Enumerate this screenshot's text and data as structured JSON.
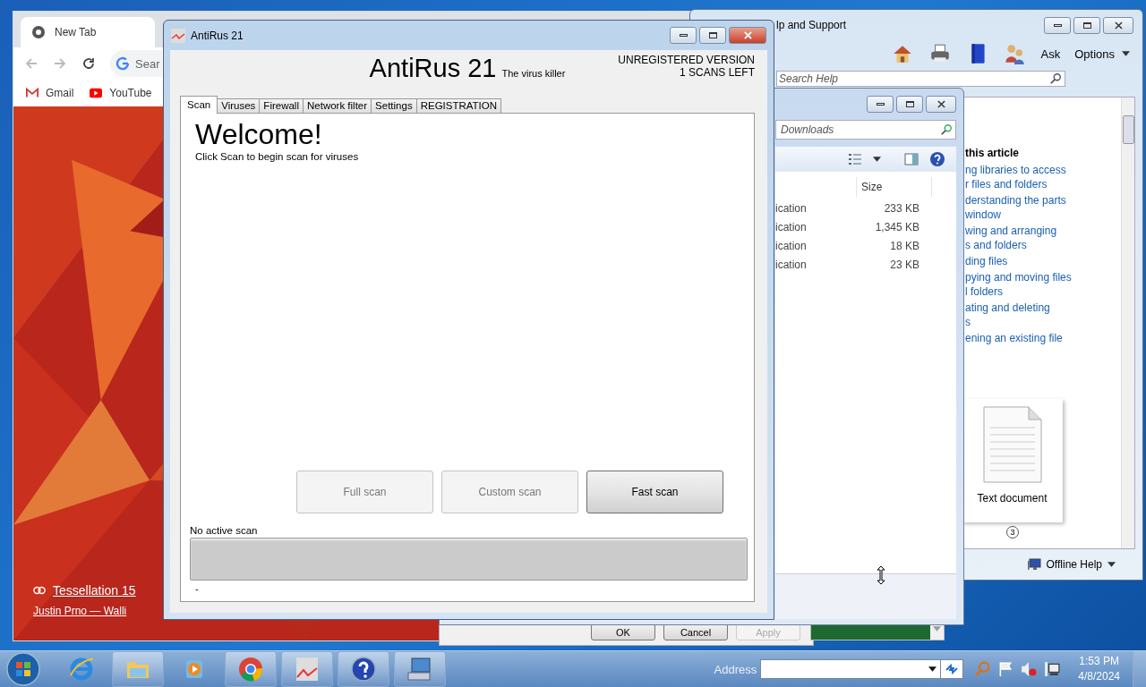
{
  "browser": {
    "tab_title": "New Tab",
    "search_placeholder": "Sear",
    "bookmarks": [
      "Gmail",
      "YouTube"
    ],
    "wallpaper_link": "Tessellation 15",
    "wallpaper_credit": "Justin Prno — Walli"
  },
  "help_window": {
    "title": "lp and Support",
    "ask": "Ask",
    "options": "Options",
    "search_placeholder": "Search Help",
    "article_heading": "this article",
    "links": [
      {
        "lines": [
          "ng libraries to access",
          "r files and folders"
        ]
      },
      {
        "lines": [
          "derstanding the parts",
          "window"
        ]
      },
      {
        "lines": [
          "wing and arranging",
          "s and folders"
        ]
      },
      {
        "lines": [
          "ding files"
        ]
      },
      {
        "lines": [
          "pying and moving files",
          "l folders"
        ]
      },
      {
        "lines": [
          "ating and deleting",
          "s"
        ]
      },
      {
        "lines": [
          "ening an existing file"
        ]
      }
    ],
    "file_label": "Text document",
    "page_badge": "3",
    "offline_help": "Offline Help"
  },
  "explorer_window": {
    "search_placeholder": "Downloads",
    "size_column": "Size",
    "rows": [
      {
        "type": "ication",
        "size": "233 KB"
      },
      {
        "type": "ication",
        "size": "1,345 KB"
      },
      {
        "type": "ication",
        "size": "18 KB"
      },
      {
        "type": "ication",
        "size": "23 KB"
      }
    ]
  },
  "dialog_behind": {
    "buttons": [
      {
        "label": "OK",
        "disabled": false
      },
      {
        "label": "Cancel",
        "disabled": false
      },
      {
        "label": "Apply",
        "disabled": true
      }
    ]
  },
  "antirus": {
    "title": "AntiRus 21",
    "app_name": "AntiRus 21",
    "tagline": "The virus killer",
    "status_lines": [
      "UNREGISTERED VERSION",
      "1 SCANS LEFT"
    ],
    "tabs": [
      {
        "label": "Scan",
        "selected": true
      },
      {
        "label": "Viruses",
        "selected": false
      },
      {
        "label": "Firewall",
        "selected": false
      },
      {
        "label": "Network filter",
        "selected": false
      },
      {
        "label": "Settings",
        "selected": false
      },
      {
        "label": "REGISTRATION",
        "selected": false
      }
    ],
    "welcome": "Welcome!",
    "instructions": "Click Scan to begin scan for viruses",
    "scan_buttons": [
      {
        "label": "Full scan",
        "disabled": true
      },
      {
        "label": "Custom scan",
        "disabled": true
      },
      {
        "label": "Fast scan",
        "disabled": false
      }
    ],
    "scan_status": "No active scan",
    "progress": {
      "level": 0
    },
    "status_detail": "-"
  },
  "taskbar": {
    "address_label": "Address",
    "time": "1:53 PM",
    "date": "4/8/2024"
  }
}
